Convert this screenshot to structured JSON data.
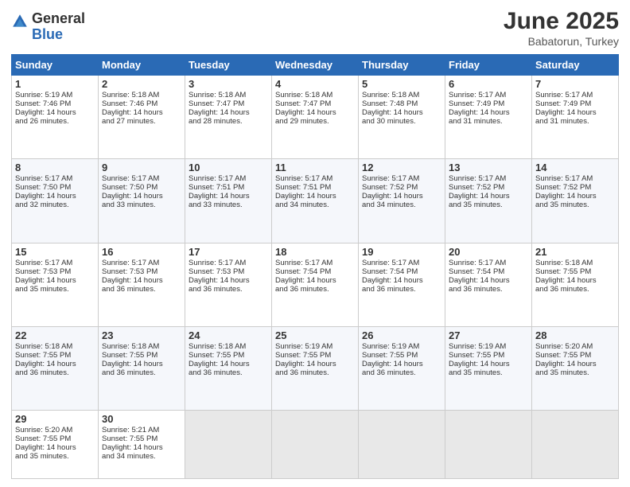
{
  "header": {
    "logo_general": "General",
    "logo_blue": "Blue",
    "month": "June 2025",
    "location": "Babatorun, Turkey"
  },
  "days_of_week": [
    "Sunday",
    "Monday",
    "Tuesday",
    "Wednesday",
    "Thursday",
    "Friday",
    "Saturday"
  ],
  "weeks": [
    [
      {
        "day": "1",
        "info": "Sunrise: 5:19 AM\nSunset: 7:46 PM\nDaylight: 14 hours\nand 26 minutes."
      },
      {
        "day": "2",
        "info": "Sunrise: 5:18 AM\nSunset: 7:46 PM\nDaylight: 14 hours\nand 27 minutes."
      },
      {
        "day": "3",
        "info": "Sunrise: 5:18 AM\nSunset: 7:47 PM\nDaylight: 14 hours\nand 28 minutes."
      },
      {
        "day": "4",
        "info": "Sunrise: 5:18 AM\nSunset: 7:47 PM\nDaylight: 14 hours\nand 29 minutes."
      },
      {
        "day": "5",
        "info": "Sunrise: 5:18 AM\nSunset: 7:48 PM\nDaylight: 14 hours\nand 30 minutes."
      },
      {
        "day": "6",
        "info": "Sunrise: 5:17 AM\nSunset: 7:49 PM\nDaylight: 14 hours\nand 31 minutes."
      },
      {
        "day": "7",
        "info": "Sunrise: 5:17 AM\nSunset: 7:49 PM\nDaylight: 14 hours\nand 31 minutes."
      }
    ],
    [
      {
        "day": "8",
        "info": "Sunrise: 5:17 AM\nSunset: 7:50 PM\nDaylight: 14 hours\nand 32 minutes."
      },
      {
        "day": "9",
        "info": "Sunrise: 5:17 AM\nSunset: 7:50 PM\nDaylight: 14 hours\nand 33 minutes."
      },
      {
        "day": "10",
        "info": "Sunrise: 5:17 AM\nSunset: 7:51 PM\nDaylight: 14 hours\nand 33 minutes."
      },
      {
        "day": "11",
        "info": "Sunrise: 5:17 AM\nSunset: 7:51 PM\nDaylight: 14 hours\nand 34 minutes."
      },
      {
        "day": "12",
        "info": "Sunrise: 5:17 AM\nSunset: 7:52 PM\nDaylight: 14 hours\nand 34 minutes."
      },
      {
        "day": "13",
        "info": "Sunrise: 5:17 AM\nSunset: 7:52 PM\nDaylight: 14 hours\nand 35 minutes."
      },
      {
        "day": "14",
        "info": "Sunrise: 5:17 AM\nSunset: 7:52 PM\nDaylight: 14 hours\nand 35 minutes."
      }
    ],
    [
      {
        "day": "15",
        "info": "Sunrise: 5:17 AM\nSunset: 7:53 PM\nDaylight: 14 hours\nand 35 minutes."
      },
      {
        "day": "16",
        "info": "Sunrise: 5:17 AM\nSunset: 7:53 PM\nDaylight: 14 hours\nand 36 minutes."
      },
      {
        "day": "17",
        "info": "Sunrise: 5:17 AM\nSunset: 7:53 PM\nDaylight: 14 hours\nand 36 minutes."
      },
      {
        "day": "18",
        "info": "Sunrise: 5:17 AM\nSunset: 7:54 PM\nDaylight: 14 hours\nand 36 minutes."
      },
      {
        "day": "19",
        "info": "Sunrise: 5:17 AM\nSunset: 7:54 PM\nDaylight: 14 hours\nand 36 minutes."
      },
      {
        "day": "20",
        "info": "Sunrise: 5:17 AM\nSunset: 7:54 PM\nDaylight: 14 hours\nand 36 minutes."
      },
      {
        "day": "21",
        "info": "Sunrise: 5:18 AM\nSunset: 7:55 PM\nDaylight: 14 hours\nand 36 minutes."
      }
    ],
    [
      {
        "day": "22",
        "info": "Sunrise: 5:18 AM\nSunset: 7:55 PM\nDaylight: 14 hours\nand 36 minutes."
      },
      {
        "day": "23",
        "info": "Sunrise: 5:18 AM\nSunset: 7:55 PM\nDaylight: 14 hours\nand 36 minutes."
      },
      {
        "day": "24",
        "info": "Sunrise: 5:18 AM\nSunset: 7:55 PM\nDaylight: 14 hours\nand 36 minutes."
      },
      {
        "day": "25",
        "info": "Sunrise: 5:19 AM\nSunset: 7:55 PM\nDaylight: 14 hours\nand 36 minutes."
      },
      {
        "day": "26",
        "info": "Sunrise: 5:19 AM\nSunset: 7:55 PM\nDaylight: 14 hours\nand 36 minutes."
      },
      {
        "day": "27",
        "info": "Sunrise: 5:19 AM\nSunset: 7:55 PM\nDaylight: 14 hours\nand 35 minutes."
      },
      {
        "day": "28",
        "info": "Sunrise: 5:20 AM\nSunset: 7:55 PM\nDaylight: 14 hours\nand 35 minutes."
      }
    ],
    [
      {
        "day": "29",
        "info": "Sunrise: 5:20 AM\nSunset: 7:55 PM\nDaylight: 14 hours\nand 35 minutes."
      },
      {
        "day": "30",
        "info": "Sunrise: 5:21 AM\nSunset: 7:55 PM\nDaylight: 14 hours\nand 34 minutes."
      },
      {
        "day": "",
        "info": ""
      },
      {
        "day": "",
        "info": ""
      },
      {
        "day": "",
        "info": ""
      },
      {
        "day": "",
        "info": ""
      },
      {
        "day": "",
        "info": ""
      }
    ]
  ]
}
